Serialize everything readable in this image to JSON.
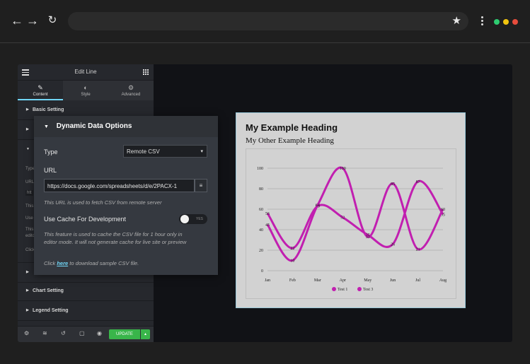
{
  "browser": {
    "back_icon": "arrow-left",
    "forward_icon": "arrow-right",
    "reload_icon": "reload",
    "back_glyph": "←",
    "forward_glyph": "→",
    "reload_glyph": "↻",
    "star_glyph": "★",
    "dots": [
      "#2ecc71",
      "#f1c40f",
      "#e74c3c"
    ]
  },
  "panel": {
    "title": "Edit Line",
    "tabs": [
      {
        "label": "Content",
        "icon": "pencil-icon",
        "glyph": "✎"
      },
      {
        "label": "Style",
        "icon": "contrast-icon",
        "glyph": "◐"
      },
      {
        "label": "Advanced",
        "icon": "gear-icon",
        "glyph": "⚙"
      }
    ],
    "sections": {
      "basic": "Basic Setting",
      "chart": "Chart Setting",
      "legend": "Legend Setting"
    },
    "ghost": {
      "type_partial": "Type",
      "url_partial": "URL",
      "input_partial": "htt",
      "this_partial": "This",
      "use_partial": "Use",
      "this2_partial": "This",
      "edit_partial": "edito",
      "click_partial": "Click"
    },
    "bottom": {
      "update_label": "UPDATE",
      "update_arrow": "▴",
      "icons": [
        "⚙",
        "≋",
        "↺",
        "▢",
        "◉"
      ]
    }
  },
  "overlay": {
    "title": "Dynamic Data Options",
    "caret": "▼",
    "type_label": "Type",
    "type_value": "Remote CSV",
    "select_arrow": "▾",
    "url_label": "URL",
    "url_value": "https://docs.google.com/spreadsheets/d/e/2PACX-1",
    "url_button_glyph": "≡",
    "url_help": "This URL is used to fetch CSV from remote server",
    "cache_label": "Use Cache For Development",
    "cache_toggle_text": "YES",
    "cache_enabled": false,
    "cache_help_1": "This feature is used to cache the CSV file for 1 hour only in",
    "cache_help_2": "editor mode. It will not generate cache for live site or preview",
    "click_pre": "Click ",
    "click_link": "here",
    "click_post": " to download sample CSV file."
  },
  "card": {
    "heading": "My Example Heading",
    "subheading": "My Other Example Heading"
  },
  "chart_data": {
    "type": "line",
    "categories": [
      "Jan",
      "Feb",
      "Mar",
      "Apr",
      "May",
      "Jun",
      "Jul",
      "Aug"
    ],
    "ylim": [
      0,
      100
    ],
    "yticks": [
      0,
      20,
      40,
      60,
      80,
      100
    ],
    "grid": true,
    "legend_position": "bottom",
    "color": "#c11fb0",
    "series": [
      {
        "name": "Test 1",
        "values": [
          56,
          22,
          63,
          52,
          35,
          26,
          87,
          55
        ]
      },
      {
        "name": "Test 3",
        "values": [
          45,
          10,
          64,
          100,
          33,
          85,
          21,
          60
        ]
      }
    ]
  }
}
